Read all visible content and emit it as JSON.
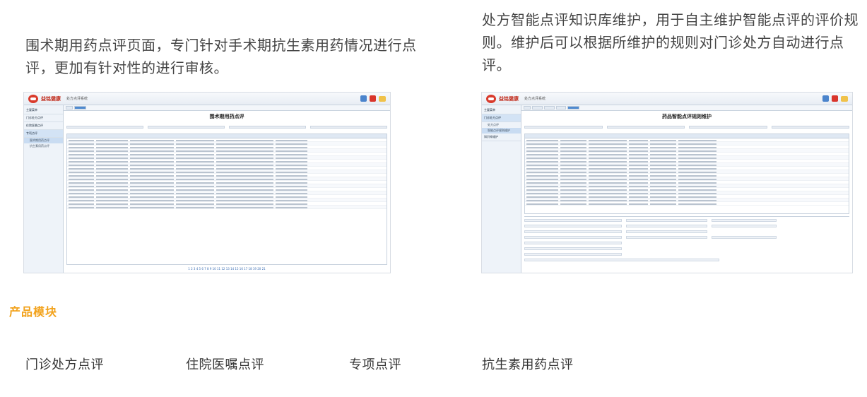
{
  "left_description": "围术期用药点评页面，专门针对手术期抗生素用药情况进行点评，更加有针对性的进行审核。",
  "right_description": "处方智能点评知识库维护，用于自主维护智能点评的评价规则。维护后可以根据所维护的规则对门诊处方自动进行点评。",
  "section_title": "产品模块",
  "modules": [
    "门诊处方点评",
    "住院医嘱点评",
    "专项点评",
    "抗生素用药点评"
  ],
  "colors": {
    "accent": "#f2a21b",
    "brand_red": "#d93a2b",
    "ui_blue": "#4f8ad0"
  },
  "left_screenshot": {
    "brand": "益铭健康",
    "app_title": "处方点评系统",
    "page_title": "围术期用药点评",
    "sidebar": [
      "主要菜单",
      "门诊处方点评",
      "住院医嘱点评",
      "专项点评"
    ],
    "sidebar_sub": [
      "围术期用药点评",
      "抗生素用药点评"
    ],
    "pager": "1 2 3 4 5 6 7 8 9 10 11 12 13 14 15 16 17 18 19 20 21"
  },
  "right_screenshot": {
    "brand": "益铭健康",
    "app_title": "处方点评系统",
    "page_title": "药品智能点评规则维护",
    "sidebar": [
      "主要菜单",
      "门诊处方点评",
      "知识库维护"
    ],
    "sidebar_sub": [
      "处方点评",
      "智能点评规则维护"
    ]
  }
}
